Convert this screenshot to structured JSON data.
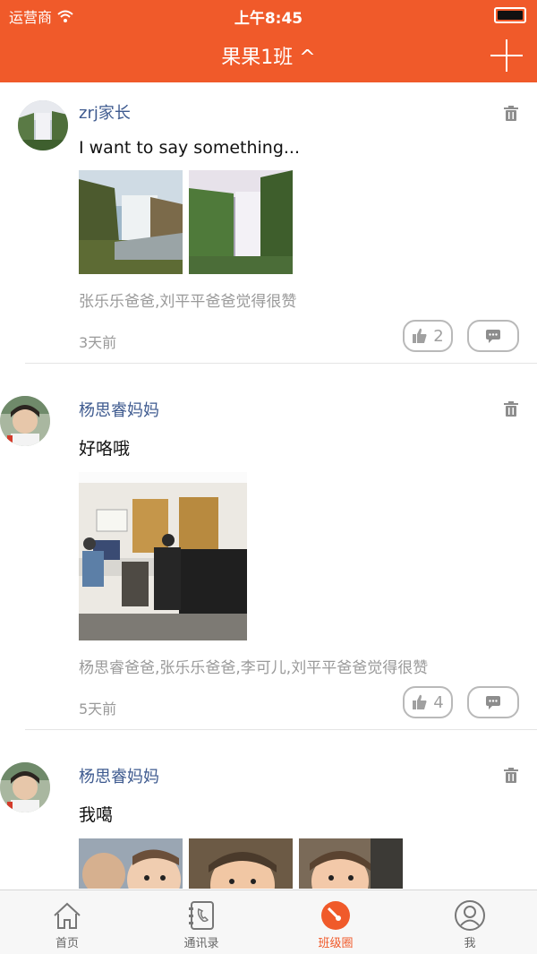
{
  "status_bar": {
    "carrier": "运营商",
    "time": "上午8:45"
  },
  "nav": {
    "title": "果果1班 ^"
  },
  "posts": [
    {
      "author": "zrj家长",
      "text": "I want to say something...",
      "likes_text": "张乐乐爸爸,刘平平爸爸觉得很赞",
      "time": "3天前",
      "like_count": "2"
    },
    {
      "author": "杨思睿妈妈",
      "text": "好咯哦",
      "likes_text": "杨思睿爸爸,张乐乐爸爸,李可儿,刘平平爸爸觉得很赞",
      "time": "5天前",
      "like_count": "4"
    },
    {
      "author": "杨思睿妈妈",
      "text": "我噶"
    }
  ],
  "tabs": [
    {
      "label": "首页",
      "icon": "home-icon"
    },
    {
      "label": "通讯录",
      "icon": "contacts-icon"
    },
    {
      "label": "班级圈",
      "icon": "class-circle-icon"
    },
    {
      "label": "我",
      "icon": "profile-icon"
    }
  ],
  "colors": {
    "accent": "#f05a2a",
    "author": "#3e5a8f",
    "muted": "#9a9a9a"
  }
}
